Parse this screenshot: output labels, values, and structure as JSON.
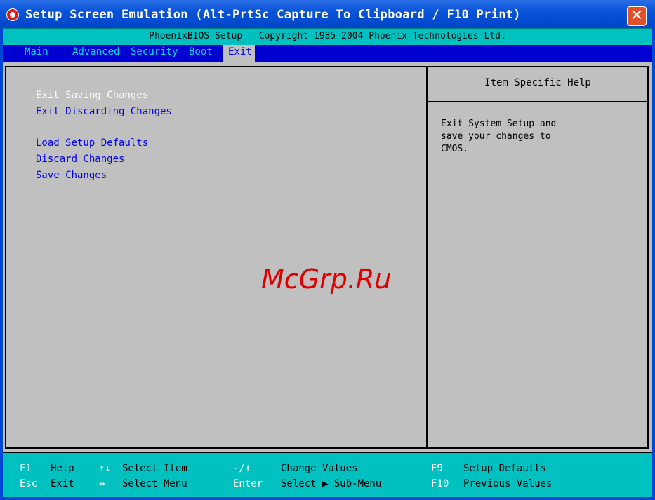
{
  "window": {
    "title": "Setup Screen Emulation (Alt-PrtSc Capture To Clipboard / F10 Print)",
    "close_glyph": "✕"
  },
  "bios": {
    "copyright": "PhoenixBIOS Setup - Copyright 1985-2004 Phoenix Technologies Ltd.",
    "tabs": [
      "Main",
      "Advanced",
      "Security",
      "Boot",
      "Exit"
    ],
    "active_tab": "Exit",
    "items": [
      "Exit Saving Changes",
      "Exit Discarding Changes",
      "Load Setup Defaults",
      "Discard Changes",
      "Save Changes"
    ],
    "selected_item": "Exit Saving Changes",
    "help_title": "Item Specific Help",
    "help_lines": [
      "Exit System Setup and",
      "save your changes to",
      "CMOS."
    ],
    "watermark": "McGrp.Ru"
  },
  "footer": {
    "row1": {
      "k1": "F1",
      "d1": "Help",
      "k2": "↑↓",
      "d2": "Select Item",
      "k3": "-/+",
      "d3": "Change Values",
      "k4": "F9",
      "d4": "Setup Defaults"
    },
    "row2": {
      "k1": "Esc",
      "d1": "Exit",
      "k2": "↔",
      "d2": "Select Menu",
      "k3": "Enter",
      "d3": "Select ▶ Sub-Menu",
      "k4": "F10",
      "d4": "Previous Values"
    }
  },
  "colors": {
    "bios_bg": "#c0c0c0",
    "menubar": "#0000d0",
    "accent_cyan": "#00c0c0",
    "item_text": "#0000ee",
    "selected_text": "#ffffff"
  }
}
